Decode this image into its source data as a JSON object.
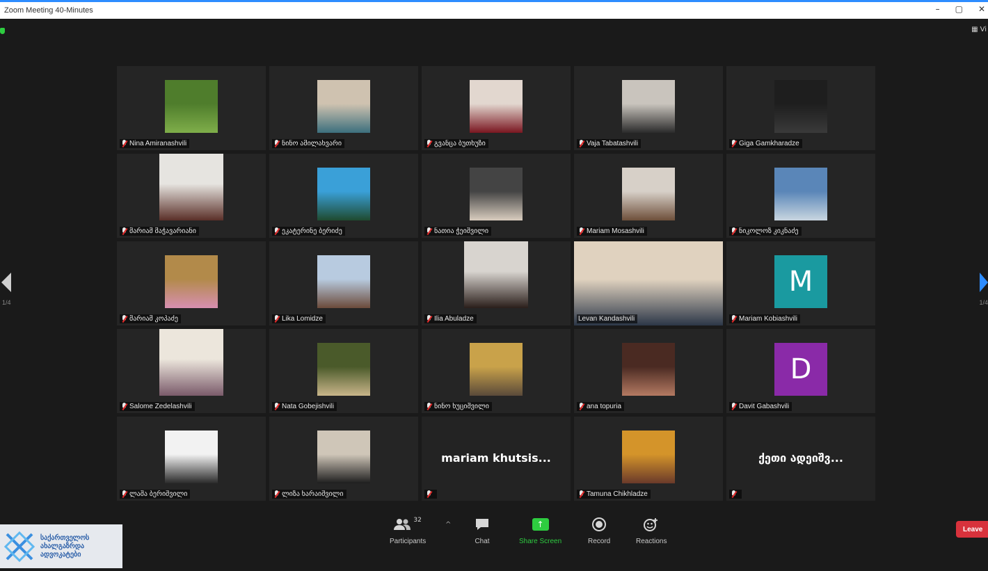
{
  "window": {
    "title": "Zoom Meeting 40-Minutes",
    "controls": [
      "–",
      "▢",
      "✕"
    ]
  },
  "header": {
    "view_label": "Vi"
  },
  "pagination": {
    "left": "1/4",
    "right": "1/4"
  },
  "participants": [
    {
      "name": "Nina Amiranashvili",
      "muted": true,
      "kind": "video",
      "bg": [
        "#4f7d2c",
        "#7fae4a"
      ]
    },
    {
      "name": "ნინო ამილახვარი",
      "muted": true,
      "kind": "video",
      "bg": [
        "#cfc2b0",
        "#3c6f7d"
      ]
    },
    {
      "name": "გვანცა ბუთხუზი",
      "muted": true,
      "kind": "video",
      "bg": [
        "#e2d7cf",
        "#7a1620"
      ]
    },
    {
      "name": "Vaja Tabatashvili",
      "muted": true,
      "kind": "video",
      "bg": [
        "#c9c4bd",
        "#2b2b2b"
      ]
    },
    {
      "name": "Giga Gamkharadze",
      "muted": true,
      "kind": "video",
      "bg": [
        "#1e1e1e",
        "#3a3a3a"
      ]
    },
    {
      "name": "მარიამ მაჭავარიანი",
      "muted": true,
      "kind": "video-tall",
      "bg": [
        "#e6e4e0",
        "#5a2f28"
      ]
    },
    {
      "name": "ეკატერინე ბერიძე",
      "muted": true,
      "kind": "video",
      "bg": [
        "#3aa0d8",
        "#1f4a2f"
      ]
    },
    {
      "name": "ნათია ჭეიშვილი",
      "muted": true,
      "kind": "video",
      "bg": [
        "#444444",
        "#d9cdbf"
      ]
    },
    {
      "name": "Mariam Mosashvili",
      "muted": true,
      "kind": "video",
      "bg": [
        "#d7d0c8",
        "#6e4f3a"
      ]
    },
    {
      "name": "ნიკოლოზ კიკნაძე",
      "muted": true,
      "kind": "video",
      "bg": [
        "#5a86b8",
        "#c9d6e0"
      ]
    },
    {
      "name": "მარიამ კოპაძე",
      "muted": true,
      "kind": "video",
      "bg": [
        "#b28a4a",
        "#d78fb1"
      ]
    },
    {
      "name": "Lika Lomidze",
      "muted": true,
      "kind": "video",
      "bg": [
        "#b8cbe0",
        "#6b4a3a"
      ]
    },
    {
      "name": "Ilia Abuladze",
      "muted": true,
      "kind": "video-tall",
      "bg": [
        "#d8d4cf",
        "#2a1e1a"
      ]
    },
    {
      "name": "Levan Kandashvili",
      "muted": false,
      "kind": "speaker",
      "active": true,
      "bg": [
        "#e0d2bf",
        "#2c3748"
      ]
    },
    {
      "name": "Mariam Kobiashvili",
      "muted": true,
      "kind": "avatar",
      "initial": "M",
      "color": "#1a9aa0"
    },
    {
      "name": "Salome Zedelashvili",
      "muted": true,
      "kind": "video-tall",
      "bg": [
        "#ece6dc",
        "#7a5a6a"
      ]
    },
    {
      "name": "Nata Gobejishvili",
      "muted": true,
      "kind": "video",
      "bg": [
        "#4a5a2a",
        "#c9b58a"
      ]
    },
    {
      "name": "ნინო ხუციშვილი",
      "muted": true,
      "kind": "video",
      "bg": [
        "#c9a24a",
        "#5a4a3a"
      ]
    },
    {
      "name": "ana topuria",
      "muted": true,
      "kind": "video",
      "bg": [
        "#4a2a22",
        "#b47a62"
      ]
    },
    {
      "name": "Davit Gabashvili",
      "muted": true,
      "kind": "avatar",
      "initial": "D",
      "color": "#8a2aa8"
    },
    {
      "name": "ლაშა ბერიშვილი",
      "muted": true,
      "kind": "video",
      "bg": [
        "#f2f2f2",
        "#2a2a2a"
      ]
    },
    {
      "name": "ლიზა ხარაიშვილი",
      "muted": true,
      "kind": "video",
      "bg": [
        "#cfc6b8",
        "#1e1e1e"
      ]
    },
    {
      "name": "",
      "muted": true,
      "kind": "name-only",
      "display_name": "mariam khutsis..."
    },
    {
      "name": "Tamuna Chikhladze",
      "muted": true,
      "kind": "video",
      "bg": [
        "#d4942a",
        "#6a3a2a"
      ]
    },
    {
      "name": "",
      "muted": true,
      "kind": "name-only",
      "display_name": "ქეთი ადეიშვ..."
    }
  ],
  "toolbar": {
    "participants_label": "Participants",
    "participants_count": "32",
    "chat_label": "Chat",
    "share_label": "Share Screen",
    "record_label": "Record",
    "reactions_label": "Reactions",
    "leave_label": "Leave",
    "colors": {
      "share": "#2ecc40",
      "leave": "#d8323c"
    }
  },
  "organization": {
    "line1": "საქართველოს",
    "line2": "ახალგაზრდა",
    "line3": "ადვოკატები"
  }
}
